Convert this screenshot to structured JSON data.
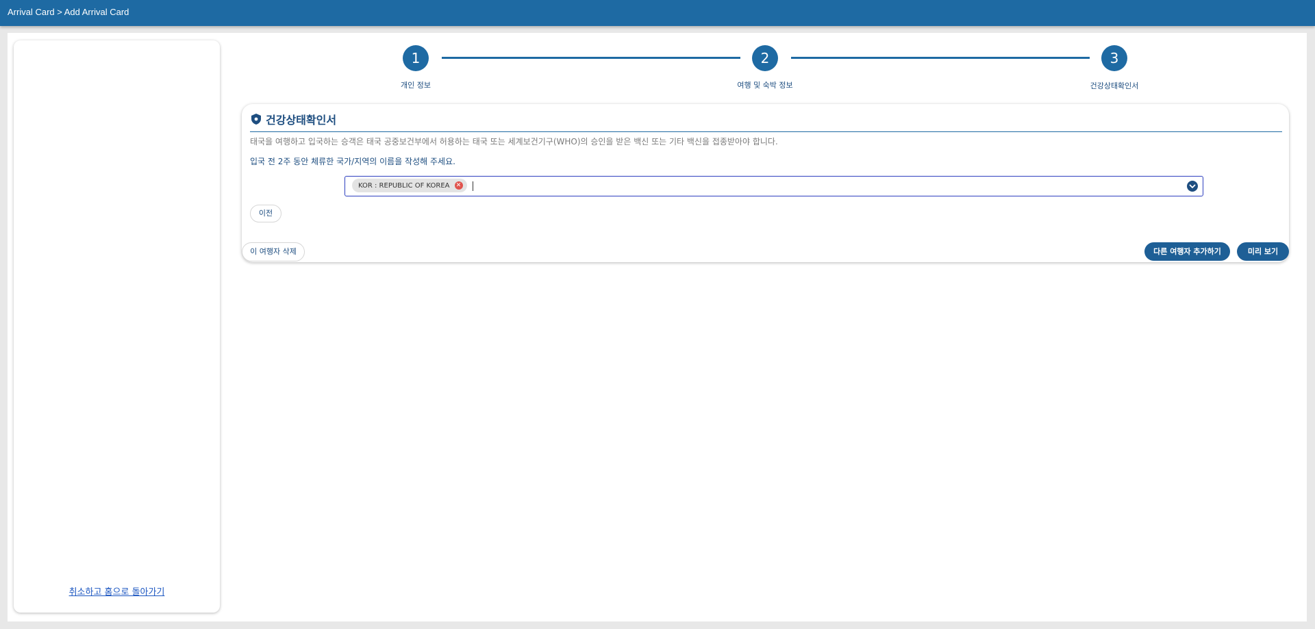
{
  "header": {
    "breadcrumb": "Arrival Card > Add Arrival Card"
  },
  "sidebar": {
    "cancel_link": "취소하고 홈으로 돌아가기"
  },
  "stepper": {
    "steps": [
      {
        "number": "1",
        "label": "개인 정보"
      },
      {
        "number": "2",
        "label": "여행 및 숙박 정보"
      },
      {
        "number": "3",
        "label": "건강상태확인서"
      }
    ]
  },
  "health_card": {
    "title": "건강상태확인서",
    "description": "태국을 여행하고 입국하는 승객은 태국 공중보건부에서 허용하는 태국 또는 세계보건기구(WHO)의 승인을 받은 백신 또는 기타 백신을 접종받아야 합니다.",
    "instruction": "입국 전 2주 동안 체류한 국가/지역의 이름을 작성해 주세요.",
    "selected_countries": [
      "KOR : REPUBLIC OF KOREA"
    ],
    "prev_button": "이전"
  },
  "actions": {
    "delete_traveler": "이 여행자 삭제",
    "add_traveler": "다른 여행자 추가하기",
    "preview": "미리 보기"
  },
  "colors": {
    "primary": "#1e6aa3",
    "dark_blue": "#1e4e80",
    "chip_remove": "#e0534d"
  }
}
